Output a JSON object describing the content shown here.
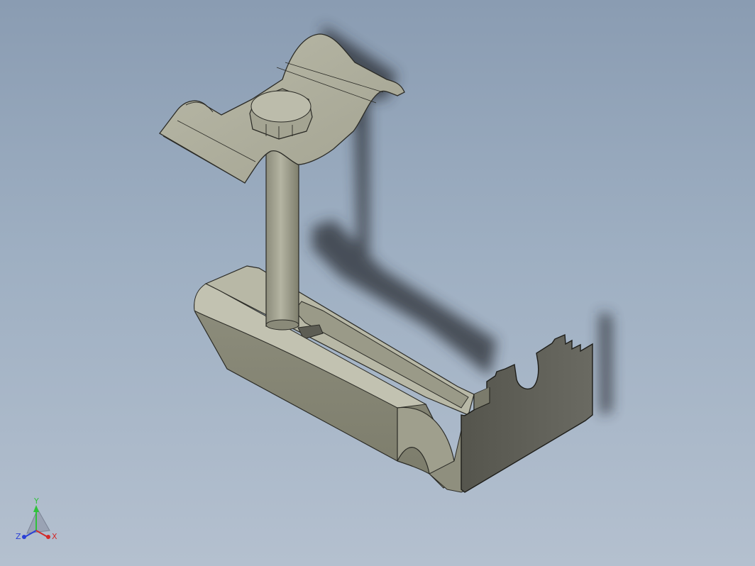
{
  "viewport": {
    "background_top": "#8a9cb2",
    "background_bottom": "#b4c0cf",
    "part_color": "#a8a896",
    "shadow_color": "#2a2e36"
  },
  "triad": {
    "y_label": "Y",
    "z_label": "Z",
    "x_label": "X",
    "y_color": "#2fc23b",
    "z_color": "#2a3fd6",
    "x_color": "#d22a2a"
  }
}
